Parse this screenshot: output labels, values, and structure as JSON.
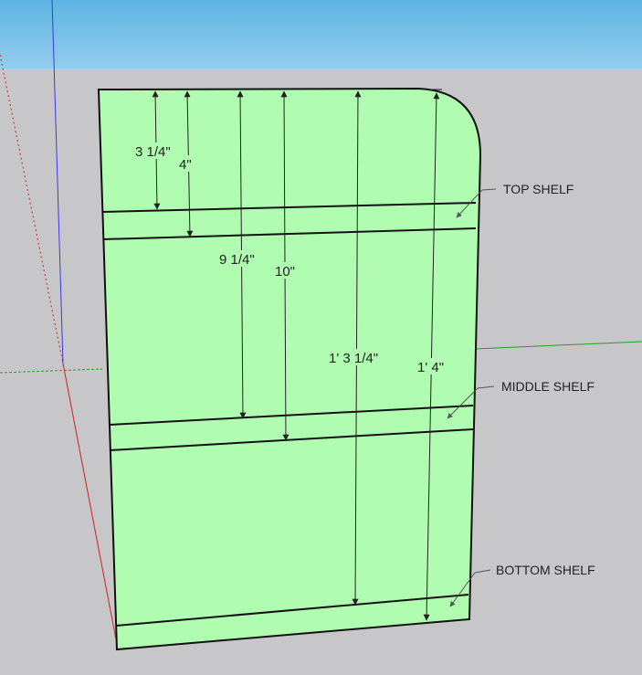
{
  "dimensions": {
    "d1": "3 1/4\"",
    "d2": "4\"",
    "d3": "9 1/4\"",
    "d4": "10\"",
    "d5": "1' 3 1/4\"",
    "d6": "1' 4\""
  },
  "labels": {
    "top": "TOP SHELF",
    "middle": "MIDDLE SHELF",
    "bottom": "BOTTOM SHELF"
  },
  "colors": {
    "panel_face": "#b0fcb0",
    "sky": "#6ab9e6",
    "ground": "#c7c7ca",
    "axis_blue": "#3a3ae0",
    "axis_green": "#2a9a2a",
    "axis_red": "#d02020"
  }
}
